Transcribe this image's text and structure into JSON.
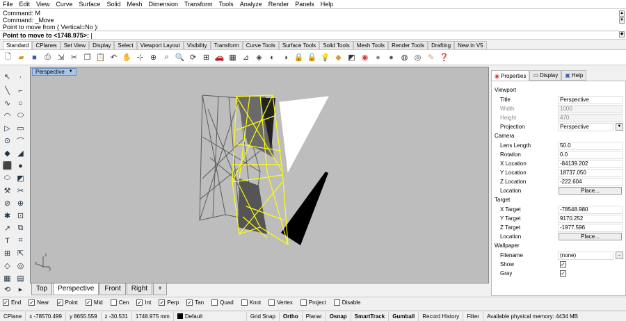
{
  "menu": [
    "File",
    "Edit",
    "View",
    "Curve",
    "Surface",
    "Solid",
    "Mesh",
    "Dimension",
    "Transform",
    "Tools",
    "Analyze",
    "Render",
    "Panels",
    "Help"
  ],
  "command": {
    "history": [
      "Command: M",
      "Command: _Move",
      "Point to move from ( Vertical=No ):"
    ],
    "prompt": "Point to move to <1748.975>:"
  },
  "toolbar_tabs": [
    "Standard",
    "CPlanes",
    "Set View",
    "Display",
    "Select",
    "Viewport Layout",
    "Visibility",
    "Transform",
    "Curve Tools",
    "Surface Tools",
    "Solid Tools",
    "Mesh Tools",
    "Render Tools",
    "Drafting",
    "New in V5"
  ],
  "toolbar_icons": [
    "new-icon",
    "open-icon",
    "save-icon",
    "print-icon",
    "import-icon",
    "cut-icon",
    "copy-icon",
    "paste-icon",
    "undo-icon",
    "pan-icon",
    "select-icon",
    "zoom-extents-icon",
    "zoom-window-icon",
    "zoom-icon",
    "rotate-view-icon",
    "four-views-icon",
    "car-icon",
    "grid-icon",
    "cplane-icon",
    "perspective-icon",
    "hide-icon",
    "show-icon",
    "lock-icon",
    "unlock-icon",
    "light-icon",
    "layer-icon",
    "properties-icon",
    "color-wheel-icon",
    "sphere-icon",
    "render-icon",
    "material-icon",
    "render-preview-icon",
    "options-icon",
    "help-icon"
  ],
  "viewport": {
    "title": "Perspective",
    "tabs": [
      "Top",
      "Perspective",
      "Front",
      "Right"
    ],
    "add_tab": "+"
  },
  "panel": {
    "tabs": [
      "Properties",
      "Display",
      "Help"
    ],
    "sections": {
      "viewport": "Viewport",
      "camera": "Camera",
      "target": "Target",
      "wallpaper": "Wallpaper"
    },
    "title_label": "Title",
    "title_value": "Perspective",
    "width_label": "Width",
    "width_value": "1000",
    "height_label": "Height",
    "height_value": "470",
    "projection_label": "Projection",
    "projection_value": "Perspective",
    "lens_label": "Lens Length",
    "lens_value": "50.0",
    "rotation_label": "Rotation",
    "rotation_value": "0.0",
    "xloc_label": "X Location",
    "xloc_value": "-84139.202",
    "yloc_label": "Y Location",
    "yloc_value": "18737.050",
    "zloc_label": "Z Location",
    "zloc_value": "-222.604",
    "location_label": "Location",
    "place_btn": "Place...",
    "tx_label": "X Target",
    "tx_value": "-78548.980",
    "ty_label": "Y Target",
    "ty_value": "9170.252",
    "tz_label": "Z Target",
    "tz_value": "-1977.596",
    "tloc_label": "Location",
    "tplace_btn": "Place...",
    "filename_label": "Filename",
    "filename_value": "(none)",
    "browse_btn": "...",
    "show_label": "Show",
    "gray_label": "Gray"
  },
  "osnaps": [
    {
      "label": "End",
      "checked": true
    },
    {
      "label": "Near",
      "checked": true
    },
    {
      "label": "Point",
      "checked": true
    },
    {
      "label": "Mid",
      "checked": true
    },
    {
      "label": "Cen",
      "checked": false
    },
    {
      "label": "Int",
      "checked": true
    },
    {
      "label": "Perp",
      "checked": true
    },
    {
      "label": "Tan",
      "checked": true
    },
    {
      "label": "Quad",
      "checked": false
    },
    {
      "label": "Knot",
      "checked": false
    },
    {
      "label": "Vertex",
      "checked": false
    },
    {
      "label": "Project",
      "checked": false
    },
    {
      "label": "Disable",
      "checked": false
    }
  ],
  "status": {
    "cplane": "CPlane",
    "x": "x -78570.499",
    "y": "y 8655.559",
    "z": "z -30.531",
    "distance": "1748.975 mm",
    "layer": "Default",
    "grid_snap": "Grid Snap",
    "ortho": "Ortho",
    "planar": "Planar",
    "osnap": "Osnap",
    "smarttrack": "SmartTrack",
    "gumball": "Gumball",
    "record_history": "Record History",
    "filter": "Filter",
    "memory": "Available physical memory: 4434 MB"
  },
  "colors": {
    "viewport_bg": "#bdbdbd",
    "selection": "#ffff00",
    "wire": "#5a5a5a",
    "title_highlight": "#a9c4e6"
  }
}
